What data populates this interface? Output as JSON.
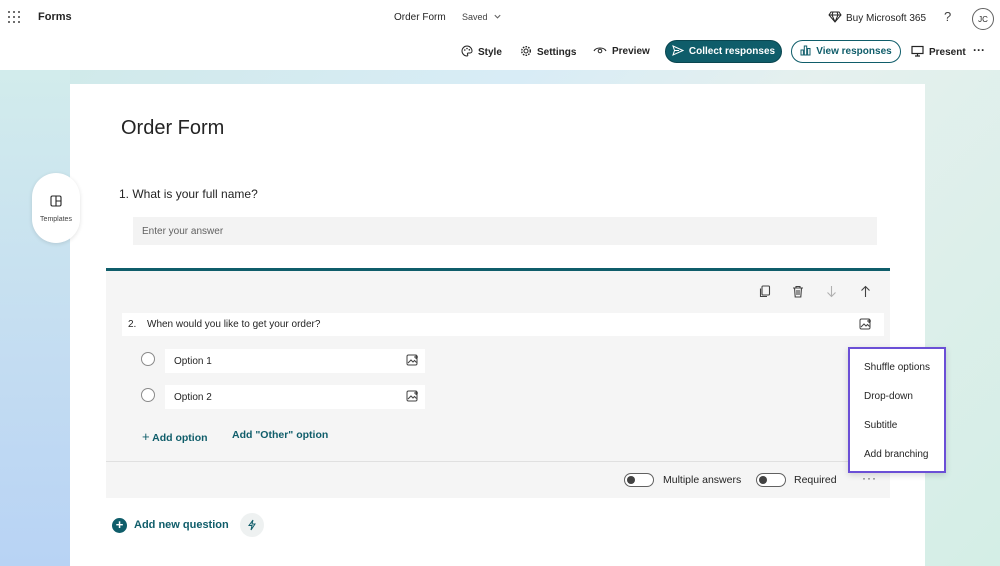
{
  "header": {
    "app_name": "Forms",
    "doc_title": "Order Form",
    "doc_status": "Saved",
    "buy_label": "Buy Microsoft 365",
    "help_label": "?",
    "avatar_initials": "JC"
  },
  "toolbar": {
    "style_label": "Style",
    "settings_label": "Settings",
    "preview_label": "Preview",
    "collect_label": "Collect responses",
    "view_label": "View responses",
    "present_label": "Present",
    "more_label": "···"
  },
  "sidebar": {
    "templates_label": "Templates"
  },
  "form": {
    "title": "Order Form",
    "questions": [
      {
        "number": "1.",
        "text": "What is your full name?",
        "placeholder": "Enter your answer"
      },
      {
        "number": "2.",
        "text": "When would you like to get your order?",
        "options": [
          "Option 1",
          "Option 2"
        ],
        "add_option_label": "Add option",
        "add_other_label": "Add \"Other\" option",
        "multiple_answers_label": "Multiple answers",
        "required_label": "Required",
        "more_label": "···"
      }
    ],
    "add_question_label": "Add new question"
  },
  "context_menu": {
    "items": [
      "Shuffle options",
      "Drop-down",
      "Subtitle",
      "Add branching"
    ]
  },
  "colors": {
    "accent": "#0f5d6a",
    "menu_border": "#6b4fd6"
  }
}
